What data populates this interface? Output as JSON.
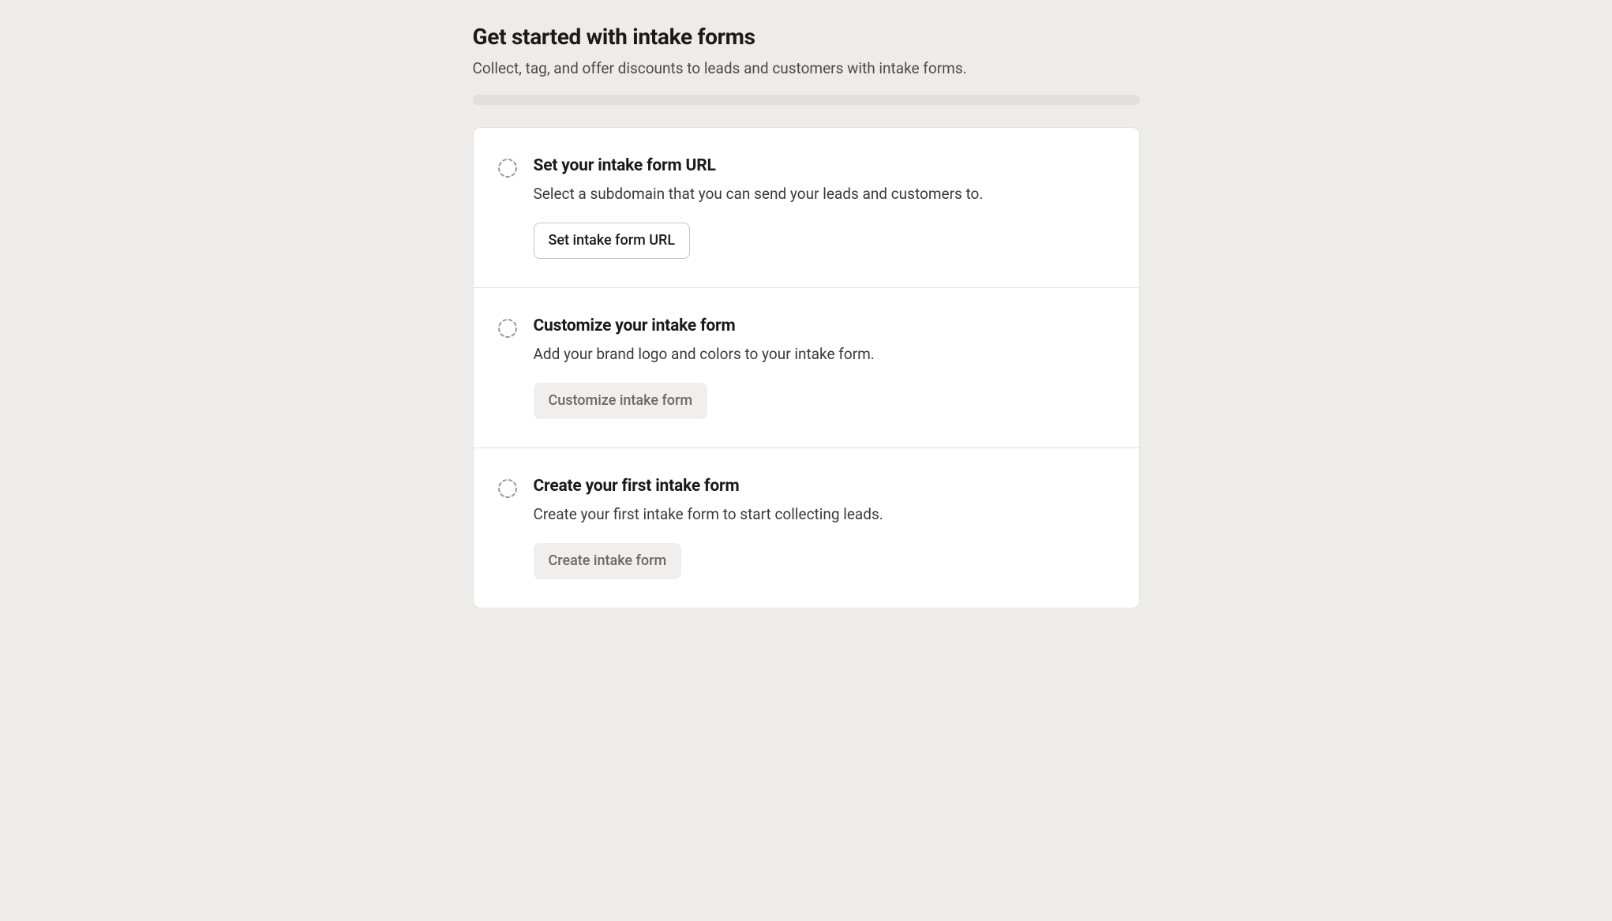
{
  "header": {
    "title": "Get started with intake forms",
    "subtitle": "Collect, tag, and offer discounts to leads and customers with intake forms."
  },
  "steps": [
    {
      "title": "Set your intake form URL",
      "description": "Select a subdomain that you can send your leads and customers to.",
      "button_label": "Set intake form URL",
      "button_enabled": true
    },
    {
      "title": "Customize your intake form",
      "description": "Add your brand logo and colors to your intake form.",
      "button_label": "Customize intake form",
      "button_enabled": false
    },
    {
      "title": "Create your first intake form",
      "description": "Create your first intake form to start collecting leads.",
      "button_label": "Create intake form",
      "button_enabled": false
    }
  ]
}
